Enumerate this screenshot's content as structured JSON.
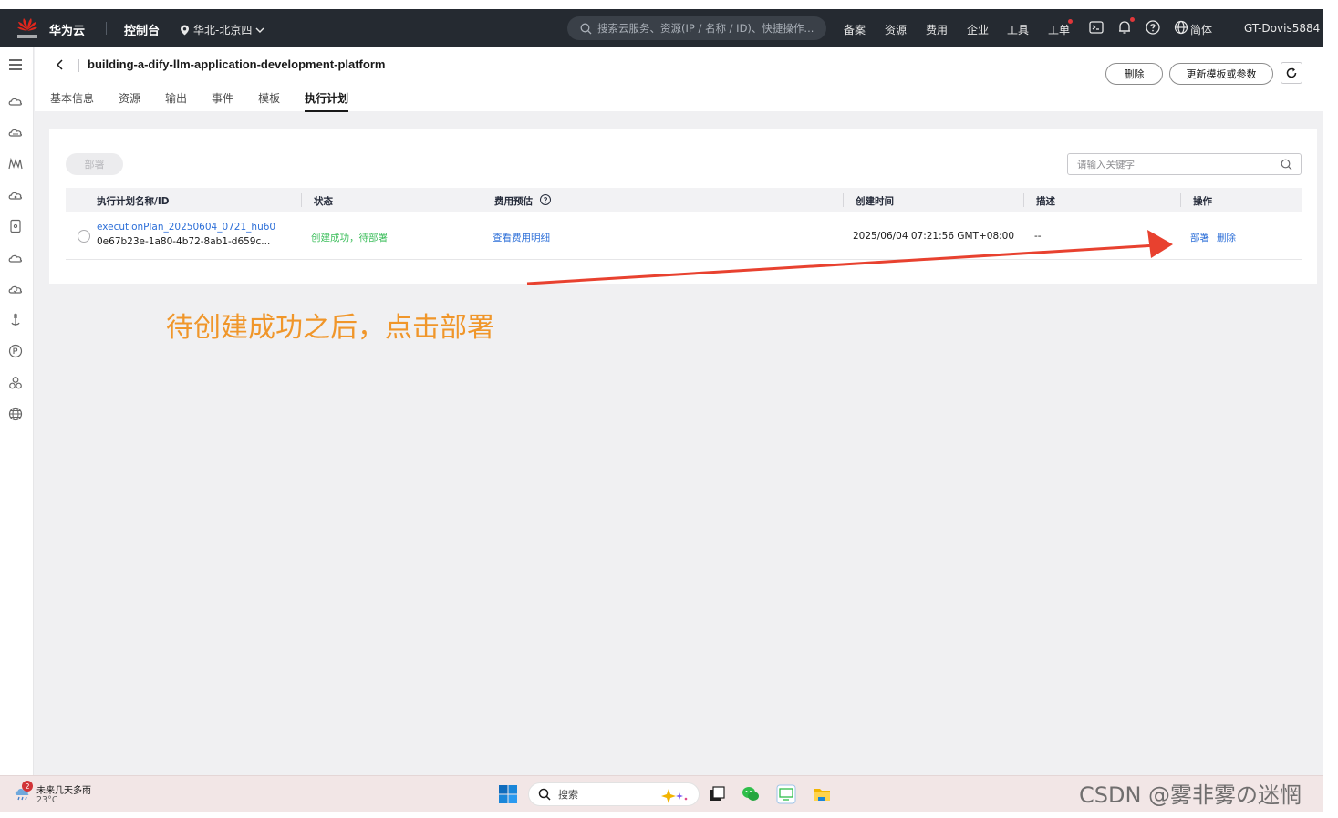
{
  "topbar": {
    "brand": "华为云",
    "console": "控制台",
    "region": "华北-北京四",
    "search_placeholder": "搜索云服务、资源(IP / 名称 / ID)、快捷操作...",
    "nav": [
      "备案",
      "资源",
      "费用",
      "企业",
      "工具",
      "工单"
    ],
    "language": "简体",
    "user": "GT-Dovis5884"
  },
  "page": {
    "title": "building-a-dify-llm-application-development-platform",
    "tabs": [
      "基本信息",
      "资源",
      "输出",
      "事件",
      "模板",
      "执行计划"
    ],
    "active_tab": "执行计划",
    "delete_label": "删除",
    "update_label": "更新模板或参数"
  },
  "table": {
    "deploy_button": "部署",
    "search_placeholder": "请输入关键字",
    "headers": [
      "执行计划名称/ID",
      "状态",
      "费用预估",
      "创建时间",
      "描述",
      "操作"
    ],
    "rows": [
      {
        "name": "executionPlan_20250604_0721_hu60",
        "id": "0e67b23e-1a80-4b72-8ab1-d659c...",
        "status": "创建成功，待部署",
        "cost": "查看费用明细",
        "created": "2025/06/04 07:21:56 GMT+08:00",
        "desc": "--",
        "action_deploy": "部署",
        "action_delete": "删除"
      }
    ]
  },
  "annotation": {
    "text": "待创建成功之后，点击部署",
    "color": "#f0962a",
    "arrow_color": "#e8412f"
  },
  "taskbar": {
    "weather_badge": "2",
    "weather_text": "未来几天多雨",
    "temperature": "23°C",
    "search_label": "搜索"
  },
  "watermark": "CSDN @雾非雾の迷惘"
}
